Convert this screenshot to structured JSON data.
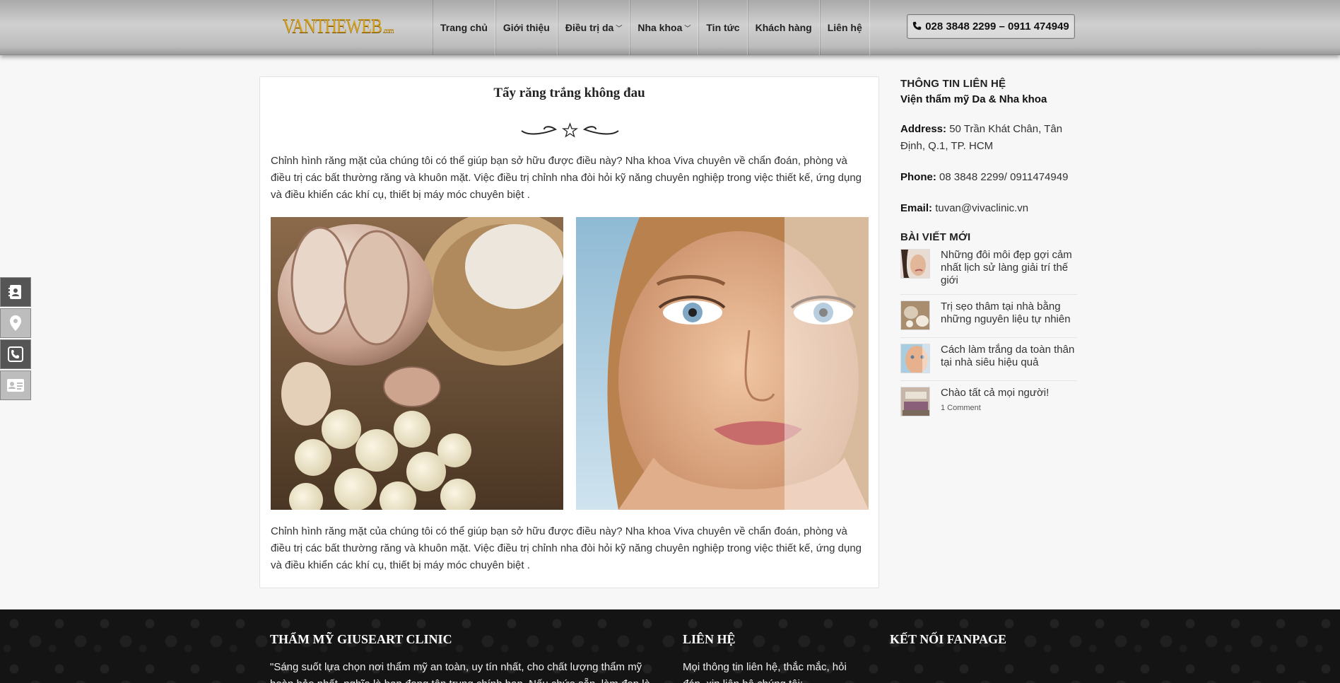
{
  "header": {
    "logo_text": "VANTHEWEB",
    "logo_sub": ".com",
    "nav": [
      {
        "label": "Trang chủ",
        "dropdown": false
      },
      {
        "label": "Giới thiệu",
        "dropdown": false
      },
      {
        "label": "Điều trị da",
        "dropdown": true
      },
      {
        "label": "Nha khoa",
        "dropdown": true
      },
      {
        "label": "Tin tức",
        "dropdown": false
      },
      {
        "label": "Khách hàng",
        "dropdown": false
      },
      {
        "label": "Liên hệ",
        "dropdown": false
      }
    ],
    "phone": "028 3848 2299 – 0911 474949",
    "phone_icon": "phone-icon"
  },
  "post": {
    "title": "Tẩy răng trắng không đau",
    "paragraph_1": "Chỉnh hình răng mặt của chúng tôi có thể giúp bạn sở hữu được điều này? Nha khoa Viva chuyên về chẩn đoán, phòng và điều trị các bất thường răng và khuôn mặt. Việc điều trị chỉnh nha đòi hỏi kỹ năng chuyên nghiệp trong việc thiết kế, ứng dụng và điều khiển các khí cụ, thiết bị máy móc chuyên biệt .",
    "paragraph_2": "Chỉnh hình răng mặt của chúng tôi có thể giúp bạn sở hữu được điều này? Nha khoa Viva chuyên về chẩn đoán, phòng và điều trị các bất thường răng và khuôn mặt. Việc điều trị chỉnh nha đòi hỏi kỹ năng chuyên nghiệp trong việc thiết kế, ứng dụng và điều khiển các khí cụ, thiết bị máy móc chuyên biệt ."
  },
  "sidebar": {
    "contact_title": "THÔNG TIN LIÊN HỆ",
    "org_name": "Viện thẩm mỹ Da & Nha khoa",
    "address_label": "Address:",
    "address_value": "50 Trần Khát Chân, Tân Định, Q.1, TP. HCM",
    "phone_label": "Phone:",
    "phone_value": "08 3848 2299/ 0911474949",
    "email_label": "Email:",
    "email_value": "tuvan@vivaclinic.vn",
    "recent_title": "BÀI VIẾT MỚI",
    "recent": [
      {
        "title": "Những đôi môi đẹp gợi cảm nhất lịch sử làng giải trí thế giới",
        "meta": ""
      },
      {
        "title": "Trị sẹo thâm tại nhà bằng những nguyên liệu tự nhiên",
        "meta": ""
      },
      {
        "title": "Cách làm trắng da toàn thân tại nhà siêu hiệu quả",
        "meta": ""
      },
      {
        "title": "Chào tất cả mọi người!",
        "meta": "1 Comment"
      }
    ]
  },
  "float_icons": [
    "contact-card-icon",
    "map-pin-icon",
    "phone-icon",
    "id-card-icon"
  ],
  "footer": {
    "col1_title": "THẨM MỸ GIUSEART CLINIC",
    "col1_text": "\"Sáng suốt lựa chọn nơi thẩm mỹ an toàn, uy tín nhất, cho chất lượng thẩm mỹ hoàn hảo nhất, nghĩa là bạn đang tận trung chính bạn. Nếu chứa sẵn, làm đẹp là phải đẹp",
    "col2_title": "LIÊN HỆ",
    "col2_text": "Mọi thông tin liên hệ, thắc mắc, hỏi đáp, xin liên hệ chúng tôi:",
    "col3_title": "KẾT NỐI FANPAGE"
  },
  "colors": {
    "logo_gold": "#d4a020",
    "footer_bg": "#141414",
    "page_bg": "#f7f7f7"
  }
}
